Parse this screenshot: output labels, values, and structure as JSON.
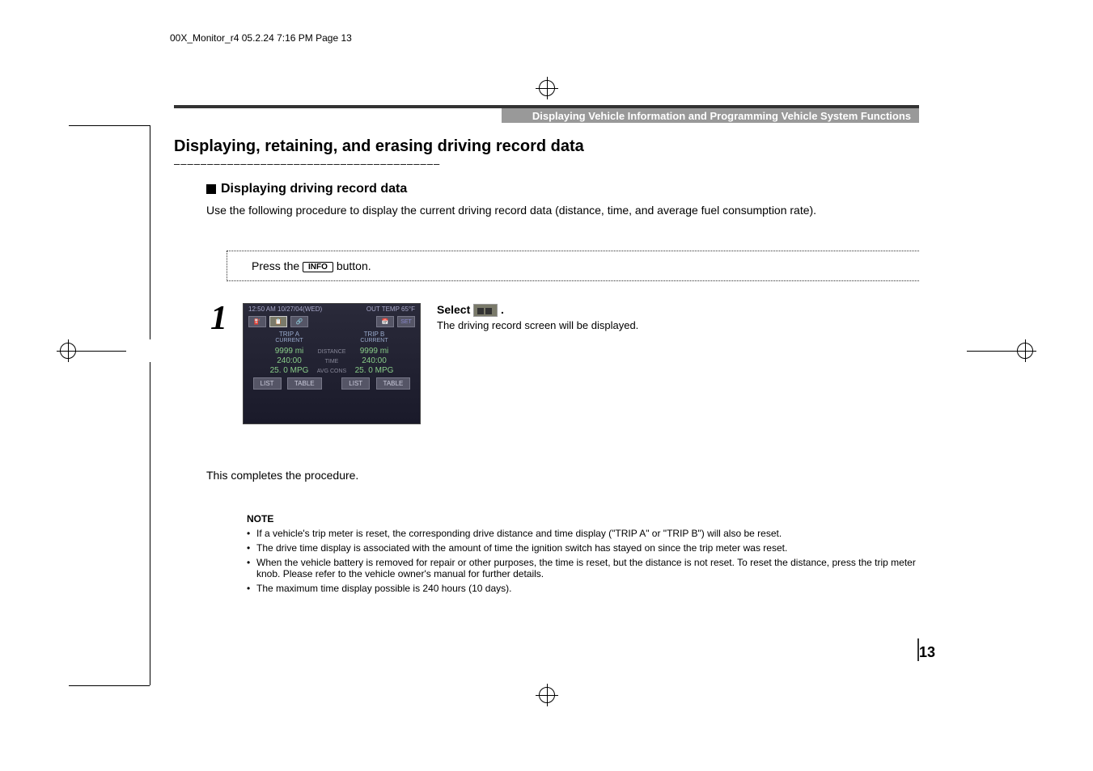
{
  "header": {
    "file_info": "00X_Monitor_r4  05.2.24  7:16 PM  Page 13"
  },
  "section_title": "Displaying Vehicle Information and Programming Vehicle System Functions",
  "main_heading": "Displaying, retaining, and erasing driving record data",
  "dashes": "––––––––––––––––––––––––––––––––––––––––",
  "subheading1": "Displaying driving record data",
  "para1": "Use the following procedure to display the current driving record data (distance, time, and average fuel consumption rate).",
  "press": {
    "pre": "Press the ",
    "btn": "INFO",
    "post": " button."
  },
  "step_num": "1",
  "screen": {
    "time": "12:50 AM 10/27/04(WED)",
    "out_temp": "OUT TEMP  65°F",
    "set": "SET",
    "trip_a": {
      "title": "TRIP A",
      "current": "CURRENT",
      "distance": "9999 mi",
      "time": "240:00",
      "cons": "25. 0 MPG"
    },
    "trip_b": {
      "title": "TRIP B",
      "current": "CURRENT",
      "distance": "9999 mi",
      "time": "240:00",
      "cons": "25. 0 MPG"
    },
    "labels": {
      "distance": "DISTANCE",
      "time": "TIME",
      "avg_cons": "AVG CONS"
    },
    "buttons": {
      "list": "LIST",
      "table": "TABLE"
    }
  },
  "select": {
    "word": "Select ",
    "period": " .",
    "sub": "The driving record screen will be displayed."
  },
  "completes": "This completes the procedure.",
  "note": {
    "title": "NOTE",
    "items": [
      "If a vehicle's trip meter is reset, the corresponding drive distance and time display (\"TRIP A\" or \"TRIP B\") will also be reset.",
      "The drive time display is associated with the amount of time the ignition switch has stayed on since the trip meter was reset.",
      "When the vehicle battery is removed for repair or other purposes, the time is reset, but the distance is not reset. To reset the distance, press the trip meter knob. Please refer to the vehicle owner's manual for further details.",
      "The maximum time display possible is 240 hours (10 days)."
    ]
  },
  "page_num": "13"
}
